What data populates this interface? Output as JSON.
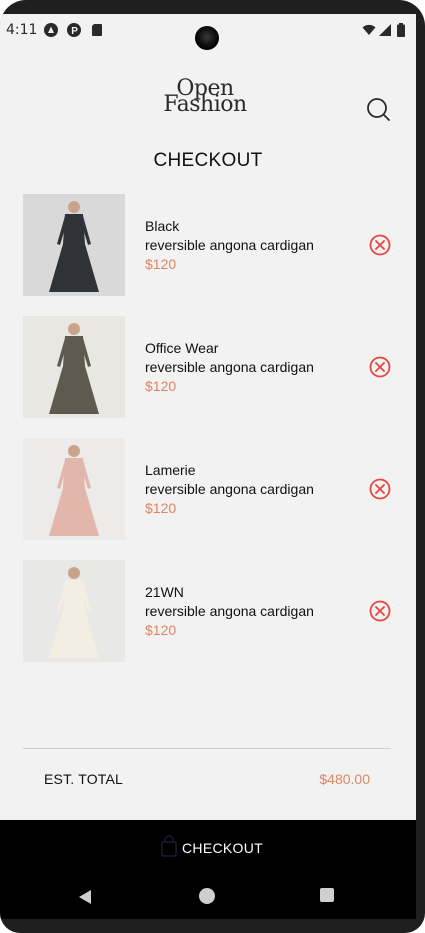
{
  "status_bar": {
    "time": "4:11",
    "left_icons": [
      "android-auto-icon",
      "p-badge-icon",
      "sd-card-icon"
    ],
    "right_icons": [
      "wifi-icon",
      "signal-icon",
      "battery-icon"
    ]
  },
  "header": {
    "logo_line1": "Open",
    "logo_line2": "Fashion",
    "search_icon": "search-icon"
  },
  "page": {
    "title": "CHECKOUT"
  },
  "items": [
    {
      "brand": "Black",
      "name": "reversible angona cardigan",
      "price": "$120",
      "dress_color": "#2f3337"
    },
    {
      "brand": "Office Wear",
      "name": "reversible angona cardigan",
      "price": "$120",
      "dress_color": "#5f5a4f"
    },
    {
      "brand": "Lamerie",
      "name": "reversible angona cardigan",
      "price": "$120",
      "dress_color": "#e2b6aa"
    },
    {
      "brand": "21WN",
      "name": "reversible angona cardigan",
      "price": "$120",
      "dress_color": "#f3ede2"
    }
  ],
  "summary": {
    "label": "EST. TOTAL",
    "value": "$480.00"
  },
  "checkout_button": {
    "label": "CHECKOUT",
    "icon": "shopping-bag-icon"
  },
  "colors": {
    "accent": "#dd8560",
    "remove": "#e8463f",
    "background": "#f2f2f2"
  },
  "nav": {
    "back_icon": "back-triangle-icon",
    "home_icon": "home-circle-icon",
    "recent_icon": "recent-apps-icon"
  }
}
